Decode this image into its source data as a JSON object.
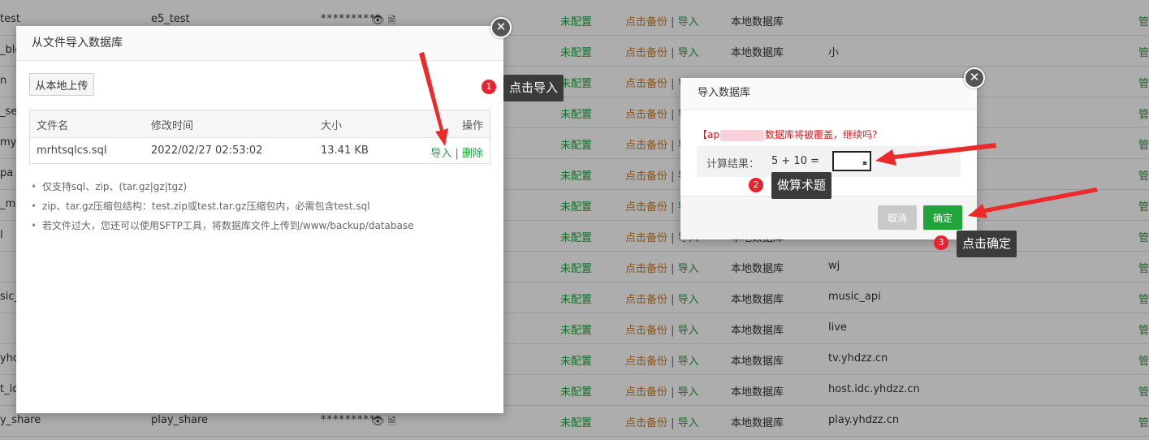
{
  "background_rows": [
    {
      "name": "test",
      "user": "e5_test",
      "password": "**********",
      "status": "未配置",
      "backup": "点击备份",
      "import": "导入",
      "location": "本地数据库",
      "note": "",
      "manage": "管"
    },
    {
      "name": "_blo",
      "user": "",
      "password": "",
      "status": "未配置",
      "backup": "点击备份",
      "import": "导入",
      "location": "本地数据库",
      "note": "小",
      "manage": "管"
    },
    {
      "name": "n",
      "user": "",
      "password": "",
      "status": "未配置",
      "backup": "点击备份",
      "import": "导入",
      "location": "",
      "note": "",
      "manage": "管"
    },
    {
      "name": "_ser",
      "user": "",
      "password": "",
      "status": "未配置",
      "backup": "点击备份",
      "import": "导入",
      "location": "",
      "note": "",
      "manage": "管"
    },
    {
      "name": "mys",
      "user": "",
      "password": "",
      "status": "未配置",
      "backup": "点击备份",
      "import": "导入",
      "location": "",
      "note": "",
      "manage": "管"
    },
    {
      "name": "pa",
      "user": "",
      "password": "",
      "status": "未配置",
      "backup": "点击备份",
      "import": "导入",
      "location": "",
      "note": "",
      "manage": "管"
    },
    {
      "name": "_ma",
      "user": "",
      "password": "",
      "status": "未配置",
      "backup": "点击备份",
      "import": "导入",
      "location": "",
      "note": "",
      "manage": "管"
    },
    {
      "name": "l",
      "user": "",
      "password": "",
      "status": "未配置",
      "backup": "点击备份",
      "import": "导入",
      "location": "本地数据库",
      "note": "",
      "manage": "管"
    },
    {
      "name": "",
      "user": "",
      "password": "",
      "status": "未配置",
      "backup": "点击备份",
      "import": "导入",
      "location": "本地数据库",
      "note": "wj",
      "manage": "管"
    },
    {
      "name": "sic_a",
      "user": "",
      "password": "",
      "status": "未配置",
      "backup": "点击备份",
      "import": "导入",
      "location": "本地数据库",
      "note": "music_api",
      "manage": "管"
    },
    {
      "name": "",
      "user": "",
      "password": "",
      "status": "未配置",
      "backup": "点击备份",
      "import": "导入",
      "location": "本地数据库",
      "note": "live",
      "manage": "管"
    },
    {
      "name": "yhdz",
      "user": "",
      "password": "",
      "status": "未配置",
      "backup": "点击备份",
      "import": "导入",
      "location": "本地数据库",
      "note": "tv.yhdzz.cn",
      "manage": "管"
    },
    {
      "name": "t_id",
      "user": "",
      "password": "",
      "status": "未配置",
      "backup": "点击备份",
      "import": "导入",
      "location": "本地数据库",
      "note": "host.idc.yhdzz.cn",
      "manage": "管"
    },
    {
      "name": "y_share",
      "user": "play_share",
      "password": "**********",
      "status": "未配置",
      "backup": "点击备份",
      "import": "导入",
      "location": "本地数据库",
      "note": "play.yhdzz.cn",
      "manage": "管"
    }
  ],
  "file_dialog": {
    "title": "从文件导入数据库",
    "close_symbol": "✕",
    "upload_label": "从本地上传",
    "columns": {
      "name": "文件名",
      "mtime": "修改时间",
      "size": "大小",
      "ops": "操作"
    },
    "file": {
      "name": "mrhtsqlcs.sql",
      "mtime": "2022/02/27 02:53:02",
      "size": "13.41 KB",
      "import": "导入",
      "sep": "|",
      "delete": "删除"
    },
    "tips": [
      "仅支持sql、zip、(tar.gz|gz|tgz)",
      "zip、tar.gz压缩包结构：test.zip或test.tar.gz压缩包内，必需包含test.sql",
      "若文件过大，您还可以使用SFTP工具，将数据库文件上传到/www/backup/database"
    ]
  },
  "confirm_dialog": {
    "title": "导入数据库",
    "close_symbol": "✕",
    "warning_prefix": "【ap",
    "warning_suffix": "数据库将被覆盖，继续吗?",
    "calc_label": "计算结果：",
    "calc_expr": "5 + 10  =",
    "calc_value": "",
    "cancel_label": "取消",
    "ok_label": "确定"
  },
  "annotations": [
    {
      "num": "1",
      "text": "点击导入"
    },
    {
      "num": "2",
      "text": "做算术题"
    },
    {
      "num": "3",
      "text": "点击确定"
    }
  ],
  "colors": {
    "accent_green": "#20a53a",
    "backup_orange": "#cf7b1c",
    "warning_red": "#e3151a",
    "annotation_red": "#e8232e",
    "arrow_red": "#ec2a2a"
  }
}
